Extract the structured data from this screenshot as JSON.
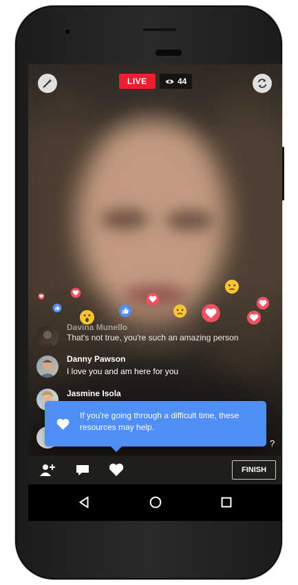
{
  "broadcast": {
    "live_label": "LIVE",
    "viewer_count": "44"
  },
  "comments": [
    {
      "name": "Davina Munello",
      "text": "That's not true, you're such an amazing person"
    },
    {
      "name": "Danny Pawson",
      "text": "I love you and am here for you"
    },
    {
      "name": "Jasmine Isola",
      "text": ""
    }
  ],
  "resource_prompt": {
    "text": "If you're going through a difficult time, these resources may help.",
    "partial_trailing_text": "?"
  },
  "toolbar": {
    "finish_label": "FINISH"
  },
  "colors": {
    "live_red": "#ee1d2f",
    "prompt_blue": "#4f8ef5",
    "like_blue": "#4f8ef5",
    "love_red": "#f24f63",
    "wow_yellow": "#f7c531"
  },
  "icons": [
    "magic-wand-icon",
    "camera-flip-icon",
    "eye-icon",
    "add-friend-icon",
    "comment-icon",
    "heart-icon",
    "back-icon",
    "home-icon",
    "recents-icon"
  ]
}
